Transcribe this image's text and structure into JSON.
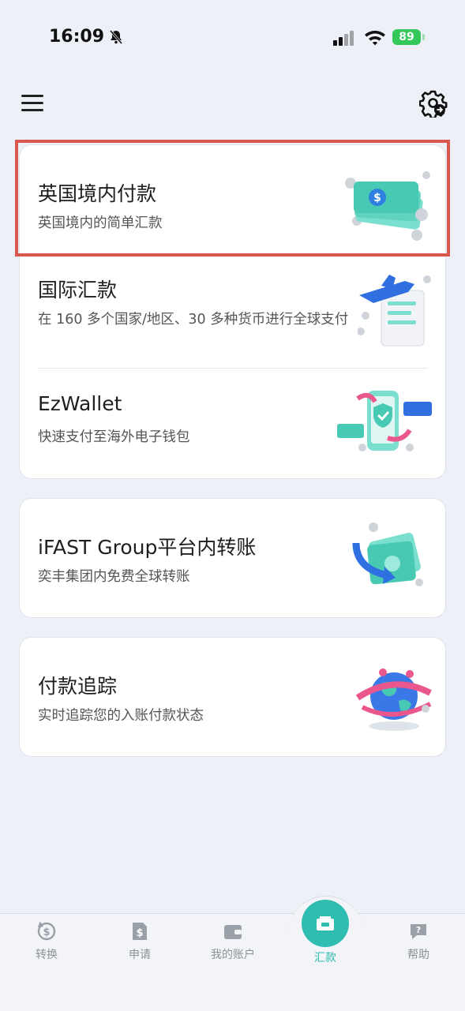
{
  "status_bar": {
    "time": "16:09",
    "battery": "89"
  },
  "payment_options": [
    {
      "title": "英国境内付款",
      "subtitle": "英国境内的简单汇款",
      "icon": "banknotes-coins-icon"
    },
    {
      "title": "国际汇款",
      "subtitle": "在 160 多个国家/地区、30 多种货币进行全球支付",
      "icon": "airplane-receipt-icon"
    },
    {
      "title": "EzWallet",
      "subtitle": "快速支付至海外电子钱包",
      "icon": "phone-wallet-transfer-icon"
    },
    {
      "title": "iFAST Group平台内转账",
      "subtitle": "奕丰集团内免费全球转账",
      "icon": "money-transfer-arrow-icon"
    },
    {
      "title": "付款追踪",
      "subtitle": "实时追踪您的入账付款状态",
      "icon": "globe-tracking-icon"
    }
  ],
  "bottom_nav": [
    {
      "label": "转换",
      "icon": "currency-convert-icon"
    },
    {
      "label": "申请",
      "icon": "document-dollar-icon"
    },
    {
      "label": "我的账户",
      "icon": "wallet-icon"
    },
    {
      "label": "汇款",
      "icon": "remittance-icon",
      "active": true
    },
    {
      "label": "帮助",
      "icon": "help-chat-icon"
    }
  ],
  "colors": {
    "accent": "#2ebdb0",
    "highlight": "#d9584d",
    "background": "#edf0f7"
  }
}
